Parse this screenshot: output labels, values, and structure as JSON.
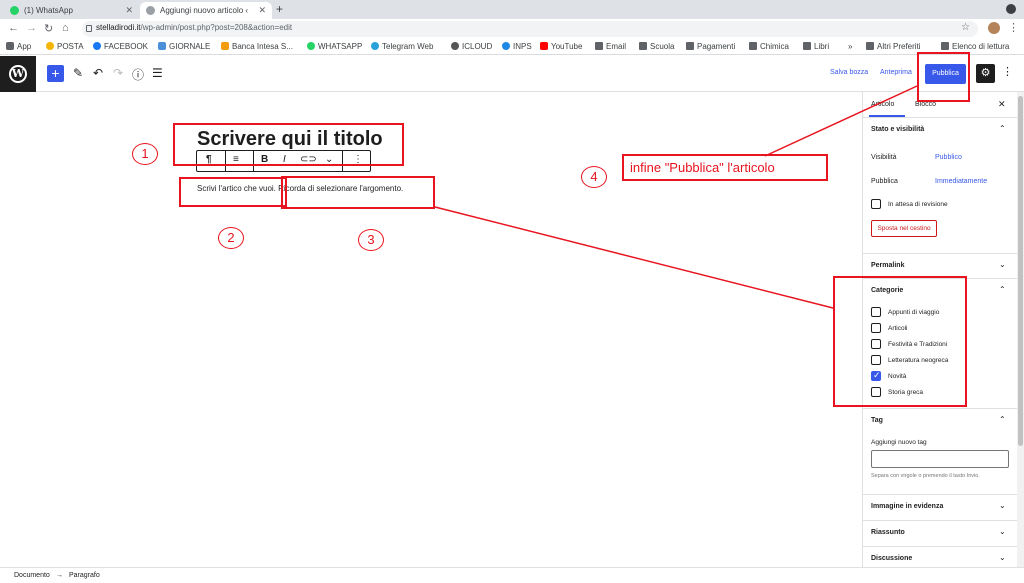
{
  "browser": {
    "tabs": [
      {
        "title": "(1) WhatsApp",
        "favicon_color": "#25d366"
      },
      {
        "title": "Aggiungi nuovo articolo ‹",
        "favicon_color": "#9aa0a6"
      }
    ],
    "url_domain": "stelladirodi.it",
    "url_path": "/wp-admin/post.php?post=208&action=edit",
    "bookmarks": [
      {
        "label": "App",
        "color": "#5f6368"
      },
      {
        "label": "POSTA",
        "color": "#f4b400"
      },
      {
        "label": "FACEBOOK",
        "color": "#1877f2"
      },
      {
        "label": "GIORNALE",
        "color": "#4a90d9"
      },
      {
        "label": "Banca Intesa S...",
        "color": "#f39c12"
      },
      {
        "label": "WHATSAPP",
        "color": "#25d366"
      },
      {
        "label": "Telegram Web",
        "color": "#2aa1da"
      },
      {
        "label": "ICLOUD",
        "color": "#555555"
      },
      {
        "label": "INPS",
        "color": "#1e88e5"
      },
      {
        "label": "YouTube",
        "color": "#ff0000"
      },
      {
        "label": "Email",
        "color": "#5f6368"
      },
      {
        "label": "Scuola",
        "color": "#5f6368"
      },
      {
        "label": "Pagamenti",
        "color": "#5f6368"
      },
      {
        "label": "Chimica",
        "color": "#5f6368"
      },
      {
        "label": "Libri",
        "color": "#5f6368"
      },
      {
        "label": "»",
        "color": ""
      },
      {
        "label": "Altri Preferiti",
        "color": "#5f6368"
      },
      {
        "label": "Elenco di lettura",
        "color": "#5f6368"
      }
    ]
  },
  "editor": {
    "save_draft": "Salva bozza",
    "preview": "Anteprima",
    "publish": "Pubblica",
    "title_text": "Scrivere qui il titolo",
    "paragraph_text": "Scrivi l'artico che vuoi. Ricorda di selezionare l'argomento."
  },
  "sidebar": {
    "tab_post": "Articolo",
    "tab_block": "Blocco",
    "status_title": "Stato e visibilità",
    "visibility_label": "Visibilità",
    "visibility_value": "Pubblico",
    "publish_label": "Pubblica",
    "publish_value": "Immediatamente",
    "pending_review": "In attesa di revisione",
    "trash": "Sposta nel cestino",
    "permalink": "Permalink",
    "categories_title": "Categorie",
    "categories": [
      {
        "label": "Appunti di viaggio",
        "checked": false
      },
      {
        "label": "Articoli",
        "checked": false
      },
      {
        "label": "Festività e Tradizioni",
        "checked": false
      },
      {
        "label": "Letteratura neogreca",
        "checked": false
      },
      {
        "label": "Novità",
        "checked": true
      },
      {
        "label": "Storia greca",
        "checked": false
      }
    ],
    "tag_title": "Tag",
    "tag_add_label": "Aggiungi nuovo tag",
    "tag_help": "Separa con virgole o premendo il tasto Invio.",
    "featured_image": "Immagine in evidenza",
    "excerpt": "Riassunto",
    "discussion": "Discussione"
  },
  "footer": {
    "doc": "Documento",
    "arrow": "→",
    "block": "Paragrafo"
  },
  "annotations": {
    "n1": "1",
    "n2": "2",
    "n3": "3",
    "n4": "4",
    "note4": "infine \"Pubblica\" l'articolo",
    "color": "#e8141f"
  }
}
